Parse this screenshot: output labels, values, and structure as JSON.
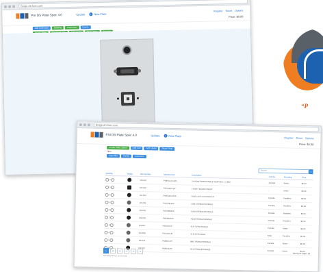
{
  "back_window": {
    "url": "Beige.dn.fuer.com",
    "brand": "PSI DS Plate Spec 4.0",
    "nav": [
      "Update",
      "New Plate"
    ],
    "right_links": [
      "Register",
      "Reset",
      "Options"
    ],
    "price": "Price: $0.00",
    "row1_buttons": [
      "Add Connector",
      "Labeling",
      "Customize",
      "Inserts"
    ],
    "row2_buttons": [
      "Create Plate",
      "Download PDF",
      "Add to Cart",
      "Share Plate",
      "Save As"
    ],
    "info_table": [
      [
        "Qty",
        "Total"
      ],
      [
        "Plate/Insert",
        "$0.00"
      ]
    ]
  },
  "front_window": {
    "url": "Beige.dn.fuer.com",
    "brand": "PSI DS Plate Spec 4.0",
    "nav": [
      "Update",
      "New Plate"
    ],
    "right_links": [
      "Register",
      "Reset",
      "Options"
    ],
    "price": "Price: $0.00",
    "row1_buttons": [
      "Create Plate Layout",
      "Add Cart",
      "Add Labels",
      "Share Plate"
    ],
    "filter_label": "Filter",
    "row2_buttons": [
      "Type filter",
      "Family",
      "Connector"
    ],
    "search_placeholder": "Search",
    "columns": [
      "Quantity",
      "Image",
      "Part Number",
      "Manufacturer",
      "Description",
      "Gender",
      "Mounting",
      "Price"
    ],
    "rows": [
      [
        "0",
        "DS-001",
        "PSIHD-2x2-WF",
        "1X HDMI FEMALE/MALE ADAPTER, 1.5 MM",
        "Female",
        "Insert",
        "$0.00"
      ],
      [
        "0",
        "DS-002",
        "PSIS-BLK-QP",
        "1 PORT BLANK INSERT",
        "-",
        "Insert",
        "$0.00"
      ],
      [
        "0",
        "DS-003",
        "PSIRJ45-C6FF",
        "RJ45 CAT6 COUPLER F/F",
        "Female",
        "Feedthru",
        "$0.00"
      ],
      [
        "0",
        "DS-004",
        "PSIUSB-AFF",
        "USB A FEMALE/FEMALE",
        "Female",
        "Feedthru",
        "$0.00"
      ],
      [
        "0",
        "DS-005",
        "PSIUSB-BFF",
        "USB B FEMALE/FEMALE",
        "Female",
        "Feedthru",
        "$0.00"
      ],
      [
        "0",
        "DS-006",
        "PSIHDMI-FF",
        "HDMI FEMALE/FEMALE",
        "Female",
        "Feedthru",
        "$0.00"
      ],
      [
        "0",
        "DS-007",
        "PSIXLR3-F",
        "XLR 3-PIN FEMALE",
        "Female",
        "Insert",
        "$0.00"
      ],
      [
        "0",
        "DS-008",
        "PSIXLR3-M",
        "XLR 3-PIN MALE",
        "Male",
        "Feedthru",
        "$0.00"
      ],
      [
        "0",
        "DS-009",
        "PSIBNC-FF",
        "BNC FEMALE/FEMALE",
        "Female",
        "Insert",
        "$0.00"
      ],
      [
        "0",
        "DS-010",
        "PSIRCA-FF",
        "RCA FEMALE/FEMALE",
        "Female",
        "Insert",
        "$0.00"
      ]
    ],
    "pages": [
      "1",
      "2",
      "3",
      "4",
      "5",
      "»"
    ],
    "footer": "Showing items 1 to 10 of 45",
    "per_page": "Items per page: 10"
  },
  "logo_slogan": "“P",
  "colors": {
    "brand_blue": "#1c62b0",
    "brand_orange": "#ef7d22",
    "btn_green": "#4cae4c",
    "btn_blue": "#3b8de0"
  }
}
